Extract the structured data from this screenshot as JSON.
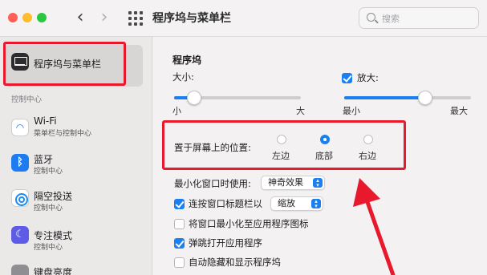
{
  "window": {
    "title": "程序坞与菜单栏"
  },
  "search": {
    "placeholder": "搜索"
  },
  "sidebar": {
    "selected_label": "程序坞与菜单栏",
    "section_header": "控制中心",
    "items": [
      {
        "label": "Wi-Fi",
        "sub": "菜单栏与控制中心",
        "icon": "wifi-icon"
      },
      {
        "label": "蓝牙",
        "sub": "控制中心",
        "icon": "bluetooth-icon"
      },
      {
        "label": "隔空投送",
        "sub": "控制中心",
        "icon": "airdrop-icon"
      },
      {
        "label": "专注模式",
        "sub": "控制中心",
        "icon": "moon-icon"
      },
      {
        "label": "键盘亮度",
        "sub": "",
        "icon": "keyboard-brightness-icon"
      }
    ]
  },
  "dock": {
    "section_title": "程序坞",
    "size_label": "大小:",
    "size_min": "小",
    "size_max": "大",
    "size_value": 0.16,
    "magnify_label": "放大:",
    "magnify_checked": true,
    "magnify_min": "最小",
    "magnify_max": "最大",
    "magnify_value": 0.64,
    "position_label": "置于屏幕上的位置:",
    "position_options": [
      "左边",
      "底部",
      "右边"
    ],
    "position_selected": "底部",
    "minimize_label": "最小化窗口时使用:",
    "minimize_value": "神奇效果",
    "dblclick_label": "连按窗口标题栏以",
    "dblclick_checked": true,
    "dblclick_value": "缩放",
    "minimize_into_icon_label": "将窗口最小化至应用程序图标",
    "minimize_into_icon_checked": false,
    "bounce_label": "弹跳打开应用程序",
    "bounce_checked": true,
    "autohide_label": "自动隐藏和显示程序坞",
    "autohide_checked": false
  },
  "colors": {
    "accent": "#1a7ff0",
    "annotation": "#e8192c"
  }
}
